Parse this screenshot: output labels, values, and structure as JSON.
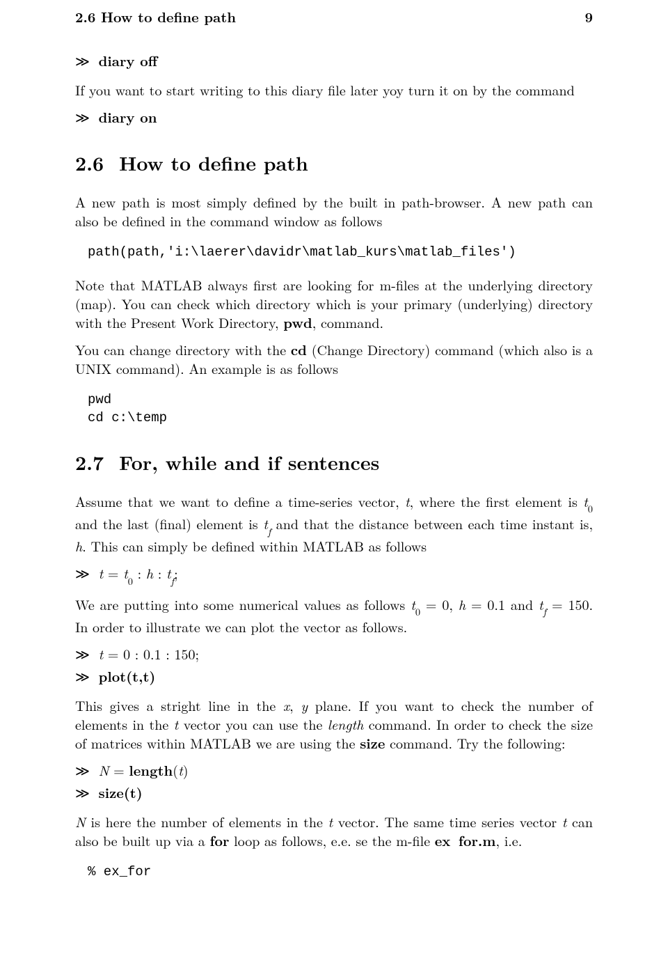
{
  "runhead": {
    "left": "2.6 How to define path",
    "right": "9"
  },
  "cmd": {
    "diary_off": "diary off",
    "diary_on": "diary on"
  },
  "p": {
    "intro_diary": "If you want to start writing to this diary file later yoy turn it on by the command"
  },
  "sec26": {
    "num": "2.6",
    "title": "How to define path",
    "p1a": "A new path is most simply defined by the built in path-browser. A new path can also be defined in the command window as follows",
    "code1": "path(path,'i:\\laerer\\davidr\\matlab_kurs\\matlab_files')",
    "p2a": "Note that MATLAB always first are looking for m-files at the underlying directory (map). You can check which directory which is your primary (underlying) directory with the Present Work Directory, ",
    "pwd": "pwd",
    "p2b": ", command.",
    "p3a": "You can change directory with the ",
    "cd": "cd",
    "p3b": " (Change Directory) command (which also is a UNIX command). An example is as follows",
    "code2": "pwd\ncd c:\\temp"
  },
  "sec27": {
    "num": "2.7",
    "title": "For, while and if sentences",
    "p1": {
      "a": "Assume that we want to define a time-series vector, ",
      "t": "t",
      "b": ", where the first element is ",
      "t0": "t",
      "t0s": "0",
      "c": " and the last (final) element is ",
      "tf": "t",
      "tfs": "f",
      "d": " and that the distance between each time instant is, ",
      "h": "h",
      "e": ". This can simply be defined within MATLAB as follows"
    },
    "cmd1": {
      "t": "t",
      "eq": " = ",
      "t0": "t",
      "t0s": "0",
      "c1": " : ",
      "h": "h",
      "c2": " : ",
      "tf": "t",
      "tfs": "f",
      "semi": ";"
    },
    "p2": {
      "a": "We are putting into some numerical values as follows ",
      "t0": "t",
      "t0s": "0",
      "eq1": " = 0, ",
      "h": "h",
      "eq2": " = 0.1 and ",
      "tf": "t",
      "tfs": "f",
      "eq3": " = 150. In order to illustrate we can plot the vector as follows."
    },
    "cmd2": {
      "a": "t",
      "b": " = 0 : 0.1 : 150;"
    },
    "cmd3": "plot(t,t)",
    "p3": {
      "a": "This gives a stright line in the ",
      "x": "x",
      "comma": ", ",
      "y": "y",
      "b": " plane. If you want to check the number of elements in the ",
      "t": "t",
      "c": " vector you can use the ",
      "length_it": "length",
      "d": " command. In order to check the size of matrices within MATLAB we are using the ",
      "size_bf": "size",
      "e": " command. Try the following:"
    },
    "cmd4": {
      "N": "N",
      "eq": " = ",
      "length": "length",
      "lp": "(",
      "t": "t",
      "rp": ")"
    },
    "cmd5": "size(t)",
    "p4": {
      "N": "N",
      "a": " is here the number of elements in the ",
      "t1": "t",
      "b": " vector. The same time series vector ",
      "t2": "t",
      "c": " can also be built up via a ",
      "for": "for",
      "d": " loop as follows, e.e. se the m-file ",
      "mfile": "ex",
      "us": "_",
      "mfile2": "for.m",
      "e": ", i.e."
    },
    "code3": "% ex_for"
  }
}
